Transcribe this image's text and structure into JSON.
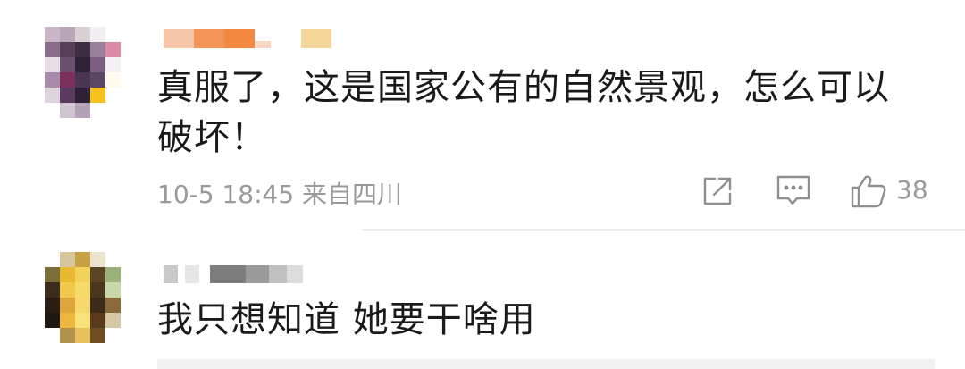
{
  "comments": [
    {
      "text": "真服了，这是国家公有的自然景观，怎么可以破坏！",
      "date": "10-5 18:45",
      "location": "来自四川",
      "likes": "38"
    },
    {
      "text": "我只想知道 她要干啥用"
    }
  ],
  "icons": {
    "share": "share-icon",
    "reply": "reply-icon",
    "like": "thumbs-up-icon"
  },
  "colors": {
    "text": "#1a1a1a",
    "meta": "#9a9a9a"
  }
}
